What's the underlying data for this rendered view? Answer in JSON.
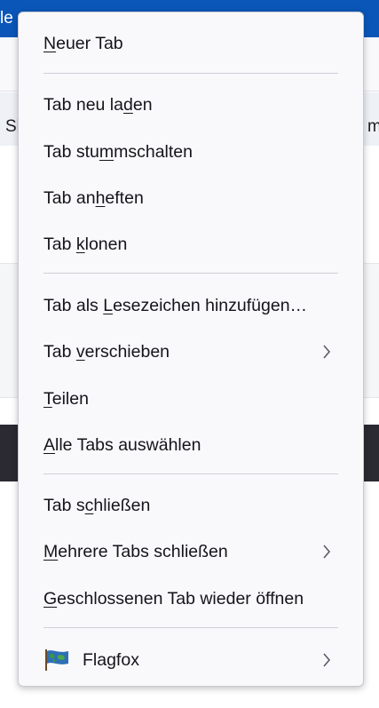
{
  "background": {
    "tabbar_left_text": "le",
    "tabbar_right_text": "",
    "row_left_text": "Sl",
    "row_right_text": "m"
  },
  "menu": {
    "items": [
      {
        "pre": "",
        "mn": "N",
        "post": "euer Tab"
      },
      {
        "pre": "Tab neu la",
        "mn": "d",
        "post": "en"
      },
      {
        "pre": "Tab stu",
        "mn": "m",
        "post": "mschalten"
      },
      {
        "pre": "Tab an",
        "mn": "h",
        "post": "eften"
      },
      {
        "pre": "Tab ",
        "mn": "k",
        "post": "lonen"
      },
      {
        "pre": "Tab als ",
        "mn": "L",
        "post": "esezeichen hinzufügen…"
      },
      {
        "pre": "Tab ",
        "mn": "v",
        "post": "erschieben",
        "submenu": true
      },
      {
        "pre": "",
        "mn": "T",
        "post": "eilen"
      },
      {
        "pre": "",
        "mn": "A",
        "post": "lle Tabs auswählen"
      },
      {
        "pre": "Tab s",
        "mn": "c",
        "post": "hließen"
      },
      {
        "pre": "",
        "mn": "M",
        "post": "ehrere Tabs schließen",
        "submenu": true
      },
      {
        "pre": "",
        "mn": "G",
        "post": "eschlossenen Tab wieder öffnen"
      },
      {
        "label": "Flagfox",
        "icon": "flagfox-globe-icon",
        "submenu": true
      }
    ]
  },
  "colors": {
    "accent": "#0a56b8",
    "menu_bg": "#f9f9fb",
    "text": "#15141a"
  }
}
